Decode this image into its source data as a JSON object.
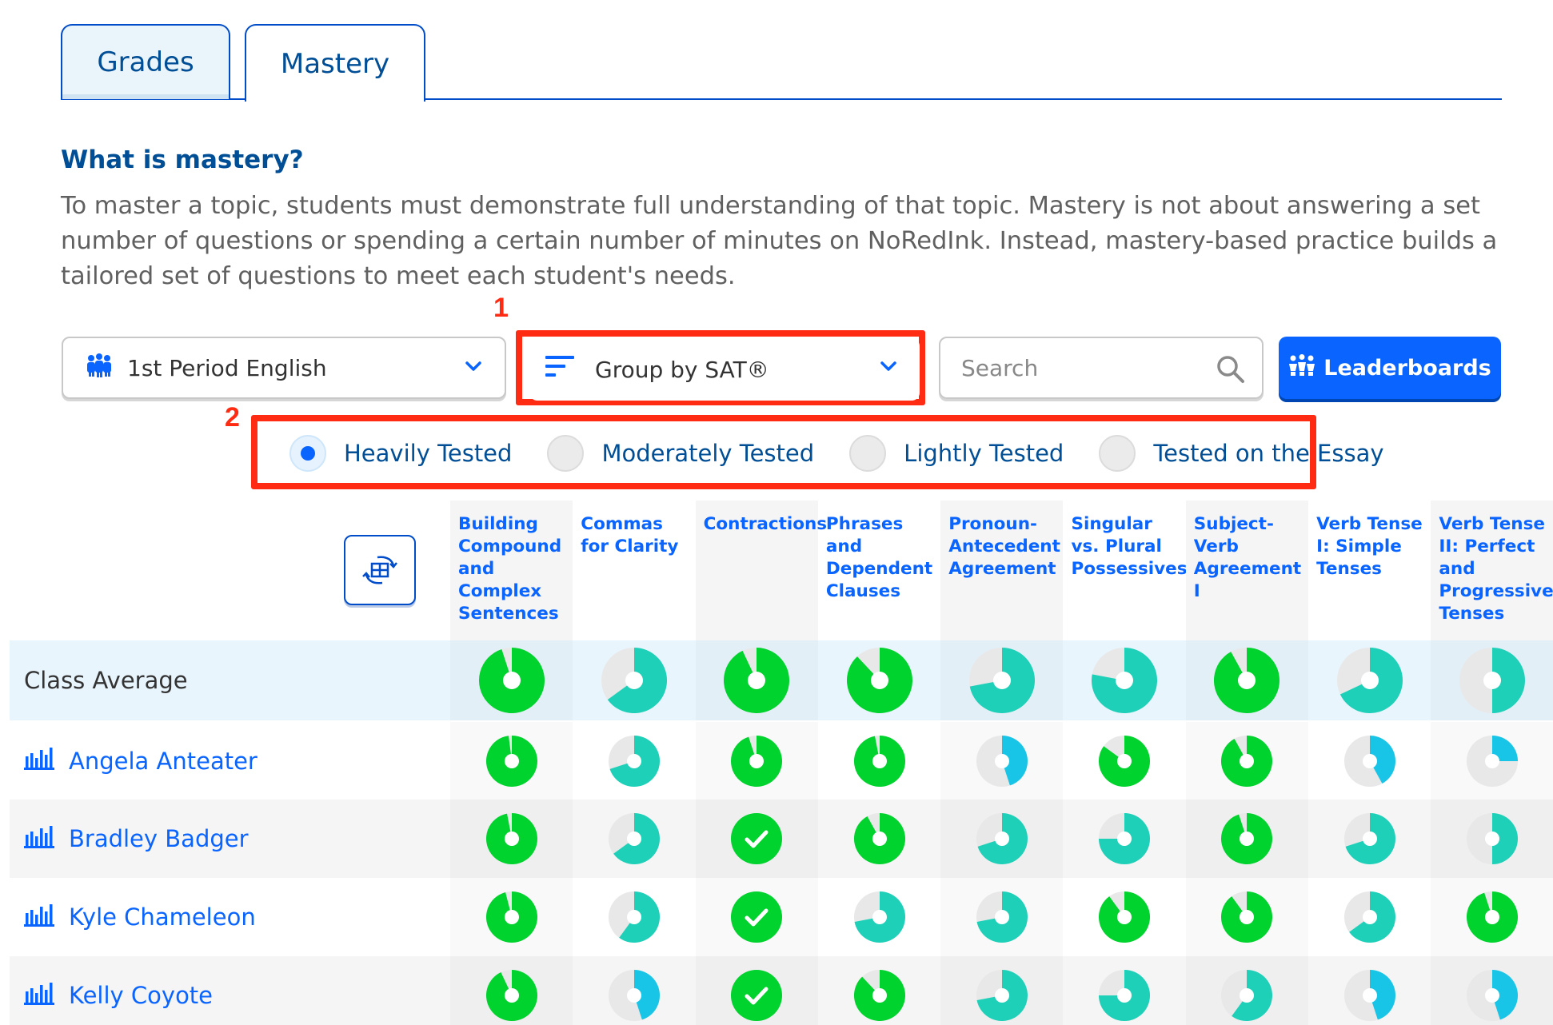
{
  "tabs": [
    {
      "label": "Grades",
      "active": false
    },
    {
      "label": "Mastery",
      "active": true
    }
  ],
  "info": {
    "heading": "What is mastery?",
    "description": "To master a topic, students must demonstrate full understanding of that topic. Mastery is not about answering a set number of questions or spending a certain number of minutes on NoRedInk. Instead, mastery-based practice builds a tailored set of questions to meet each student's needs."
  },
  "annotations": {
    "first": "1",
    "second": "2"
  },
  "controls": {
    "class_select": {
      "value": "1st Period English",
      "icon": "people-icon"
    },
    "group_select": {
      "value": "Group by SAT®",
      "icon": "sort-icon"
    },
    "search": {
      "placeholder": "Search"
    },
    "leaderboards_button": {
      "label": "Leaderboards",
      "icon": "trophy-people-icon"
    }
  },
  "filters": [
    {
      "label": "Heavily Tested",
      "selected": true
    },
    {
      "label": "Moderately Tested",
      "selected": false
    },
    {
      "label": "Lightly Tested",
      "selected": false
    },
    {
      "label": "Tested on the Essay",
      "selected": false
    }
  ],
  "columns": [
    "Building Compound and Complex Sentences",
    "Commas for Clarity",
    "Contractions",
    "Phrases and Dependent Clauses",
    "Pronoun-Antecedent Agreement",
    "Singular vs. Plural Possessives",
    "Subject-Verb Agreement I",
    "Verb Tense I: Simple Tenses",
    "Verb Tense II: Perfect and Progressive Tenses"
  ],
  "rows": [
    {
      "name": "Class Average",
      "type": "average",
      "mastery": [
        0.95,
        0.65,
        0.93,
        0.88,
        0.72,
        0.78,
        0.92,
        0.68,
        0.5
      ]
    },
    {
      "name": "Angela Anteater",
      "type": "student",
      "mastery": [
        0.98,
        0.7,
        0.95,
        0.97,
        0.45,
        0.85,
        0.92,
        0.42,
        0.25
      ]
    },
    {
      "name": "Bradley Badger",
      "type": "student",
      "mastery": [
        0.97,
        0.65,
        1.0,
        0.92,
        0.7,
        0.75,
        0.95,
        0.7,
        0.5
      ]
    },
    {
      "name": "Kyle Chameleon",
      "type": "student",
      "mastery": [
        0.96,
        0.6,
        1.0,
        0.72,
        0.72,
        0.9,
        0.9,
        0.65,
        0.95
      ]
    },
    {
      "name": "Kelly Coyote",
      "type": "student",
      "mastery": [
        0.93,
        0.45,
        1.0,
        0.88,
        0.72,
        0.75,
        0.6,
        0.45,
        0.45
      ]
    }
  ],
  "colors": {
    "mastered": "#00d22e",
    "mid": "#1ed0b8",
    "low": "#19c5e6",
    "empty": "#e8e8e8",
    "link": "#0a64ff",
    "navy": "#004e95",
    "annotation": "#ff2b12"
  }
}
